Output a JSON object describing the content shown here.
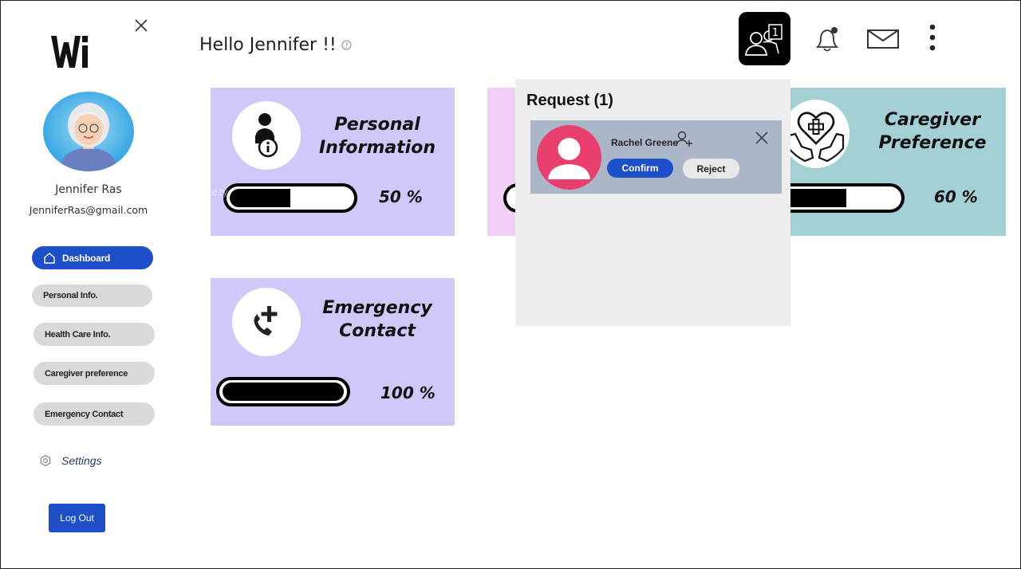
{
  "sidebar": {
    "user_name": "Jennifer Ras",
    "user_email": "JenniferRas@gmail.com",
    "nav": {
      "dashboard": "Dashboard",
      "personal_info": "Personal Info.",
      "health_care_info": "Health Care Info.",
      "caregiver_preference": "Caregiver preference",
      "emergency_contact": "Emergency Contact"
    },
    "settings_label": "Settings",
    "logout_label": "Log Out"
  },
  "header": {
    "greeting": "Hello Jennifer !!",
    "request_count": "1"
  },
  "cards": {
    "personal": {
      "title_line1": "Personal",
      "title_line2": "Information",
      "percent_label": "50 %",
      "progress": 0.5
    },
    "caregiver": {
      "title_line1": "Caregiver",
      "title_line2": "Preference",
      "percent_label": "60 %",
      "progress": 0.6
    },
    "emergency": {
      "title_line1": "Emergency",
      "title_line2": "Contact",
      "percent_label": "100 %",
      "progress": 1.0
    }
  },
  "request_popup": {
    "title": "Request (1)",
    "requester_name": "Rachel Greene",
    "confirm_label": "Confirm",
    "reject_label": "Reject"
  },
  "colors": {
    "accent": "#1d4fc8",
    "card_purple": "#cfc8f8",
    "card_pink": "#f1cff6",
    "card_teal": "#a3d0d5",
    "requester_avatar": "#e83f6f"
  },
  "icons": [
    "close-icon",
    "home-icon",
    "settings-icon",
    "help-icon",
    "request-icon",
    "bell-icon",
    "mail-icon",
    "more-icon",
    "person-info-icon",
    "phone-plus-icon",
    "heart-hands-icon",
    "add-user-icon"
  ]
}
